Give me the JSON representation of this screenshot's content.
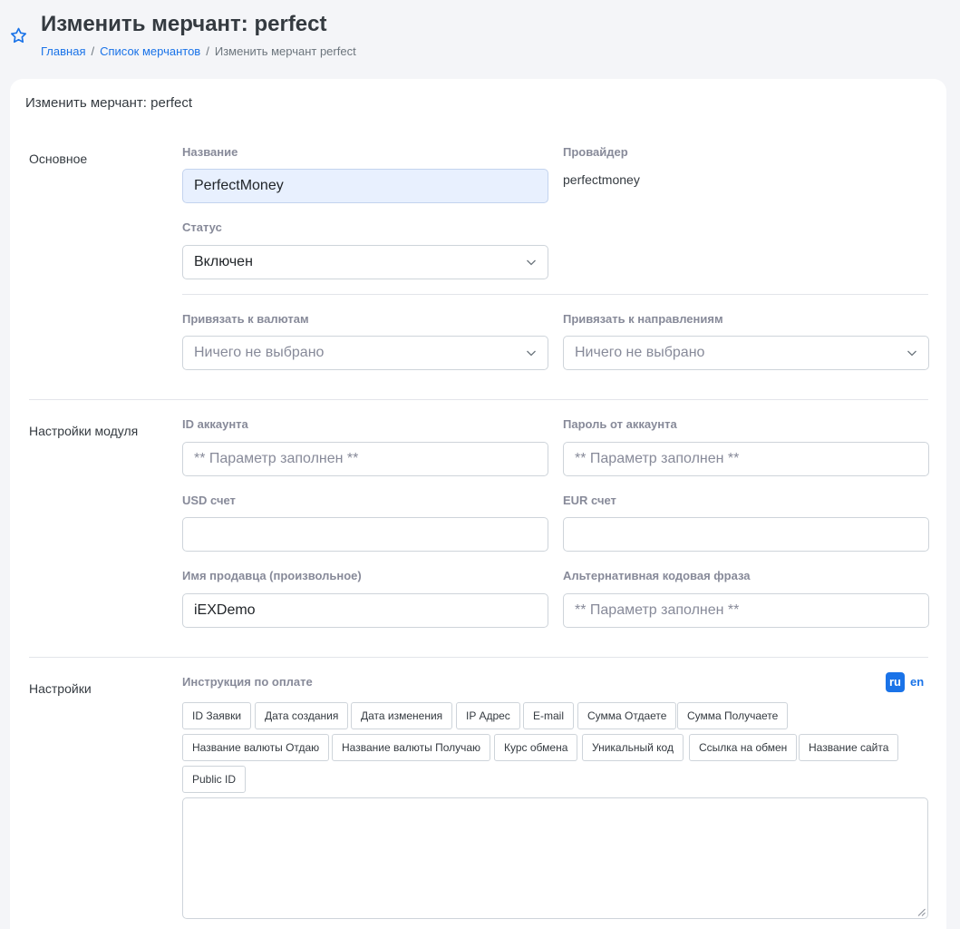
{
  "header": {
    "title": "Изменить мерчант: perfect",
    "breadcrumb": {
      "home": "Главная",
      "list": "Список мерчантов",
      "current": "Изменить мерчант perfect"
    }
  },
  "card": {
    "title": "Изменить мерчант: perfect"
  },
  "basic": {
    "section_label": "Основное",
    "name_label": "Название",
    "name_value": "PerfectMoney",
    "provider_label": "Провайдер",
    "provider_value": "perfectmoney",
    "status_label": "Статус",
    "status_value": "Включен",
    "currencies_label": "Привязать к валютам",
    "currencies_placeholder": "Ничего не выбрано",
    "directions_label": "Привязать к направлениям",
    "directions_placeholder": "Ничего не выбрано"
  },
  "module": {
    "section_label": "Настройки модуля",
    "account_id_label": "ID аккаунта",
    "account_id_value": "** Параметр заполнен **",
    "password_label": "Пароль от аккаунта",
    "password_value": "** Параметр заполнен **",
    "usd_label": "USD счет",
    "usd_value": "",
    "eur_label": "EUR счет",
    "eur_value": "",
    "seller_label": "Имя продавца (произвольное)",
    "seller_value": "iEXDemo",
    "alt_phrase_label": "Альтернативная кодовая фраза",
    "alt_phrase_value": "** Параметр заполнен **"
  },
  "settings": {
    "section_label": "Настройки",
    "instruction_label": "Инструкция по оплате",
    "lang_ru": "ru",
    "lang_en": "en",
    "tags": [
      "ID Заявки",
      "Дата создания",
      "Дата изменения",
      "IP Адрес",
      "E-mail",
      "Сумма Отдаете",
      "Сумма Получаете",
      "Название валюты Отдаю",
      "Название валюты Получаю",
      "Курс обмена",
      "Уникальный код",
      "Ссылка на обмен",
      "Название сайта",
      "Public ID"
    ],
    "instruction_value": ""
  },
  "colors": {
    "accent": "#1a73e8",
    "page_bg": "#f4f5f8",
    "label_gray": "#878a99",
    "autofill_bg": "#e8f0fe"
  },
  "icons": {
    "favorite": "star-icon",
    "select_arrow": "chevron-down-icon",
    "resize": "resize-handle-icon"
  }
}
